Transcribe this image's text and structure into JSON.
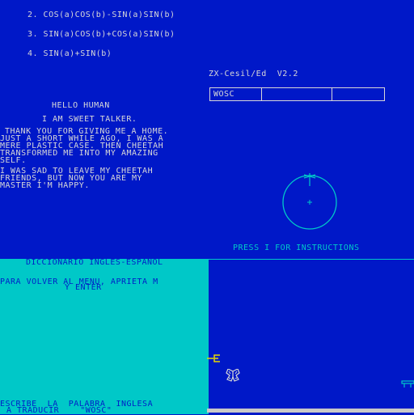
{
  "formulas": [
    "2. COS(a)COS(b)-SIN(a)SIN(b)",
    "3. SIN(a)COS(b)+COS(a)SIN(b)",
    "4. SIN(a)+SIN(b)"
  ],
  "app_title": "ZX-Cesil/Ed  V2.2",
  "table": {
    "cells": [
      "WOSC",
      "",
      "",
      ""
    ]
  },
  "talker": {
    "greeting": "HELLO HUMAN",
    "intro": "I AM SWEET TALKER.",
    "paragraph1": [
      "THANK YOU FOR GIVING ME A HOME.",
      "JUST A SHORT WHILE AGO, I WAS A",
      "MERE PLASTIC CASE. THEN CHEETAH",
      "TRANSFORMED ME INTO MY AMAZING",
      "SELF."
    ],
    "paragraph2": [
      "I WAS SAD TO LEAVE MY CHEETAH",
      "FRIENDS, BUT NOW YOU ARE MY",
      "MASTER I'M HAPPY."
    ]
  },
  "instructions_prompt": "PRESS I FOR INSTRUCTIONS",
  "dictionary": {
    "title": "DICCIONARIO INGLES-ESPAÑOL",
    "menu_hint_line1": "PARA VOLVER AL MENU, APRIETA M",
    "menu_hint_line2": "Y ENTER",
    "prompt_line1": "ESCRIBE  LA  PALABRA  INGLESA",
    "prompt_line2": "A TRADUCIR    \"WOSC\""
  },
  "colors": {
    "background": "#0018c8",
    "cyan": "#00c8c8",
    "text": "#d8d8d8",
    "yellow": "#e8d800"
  }
}
